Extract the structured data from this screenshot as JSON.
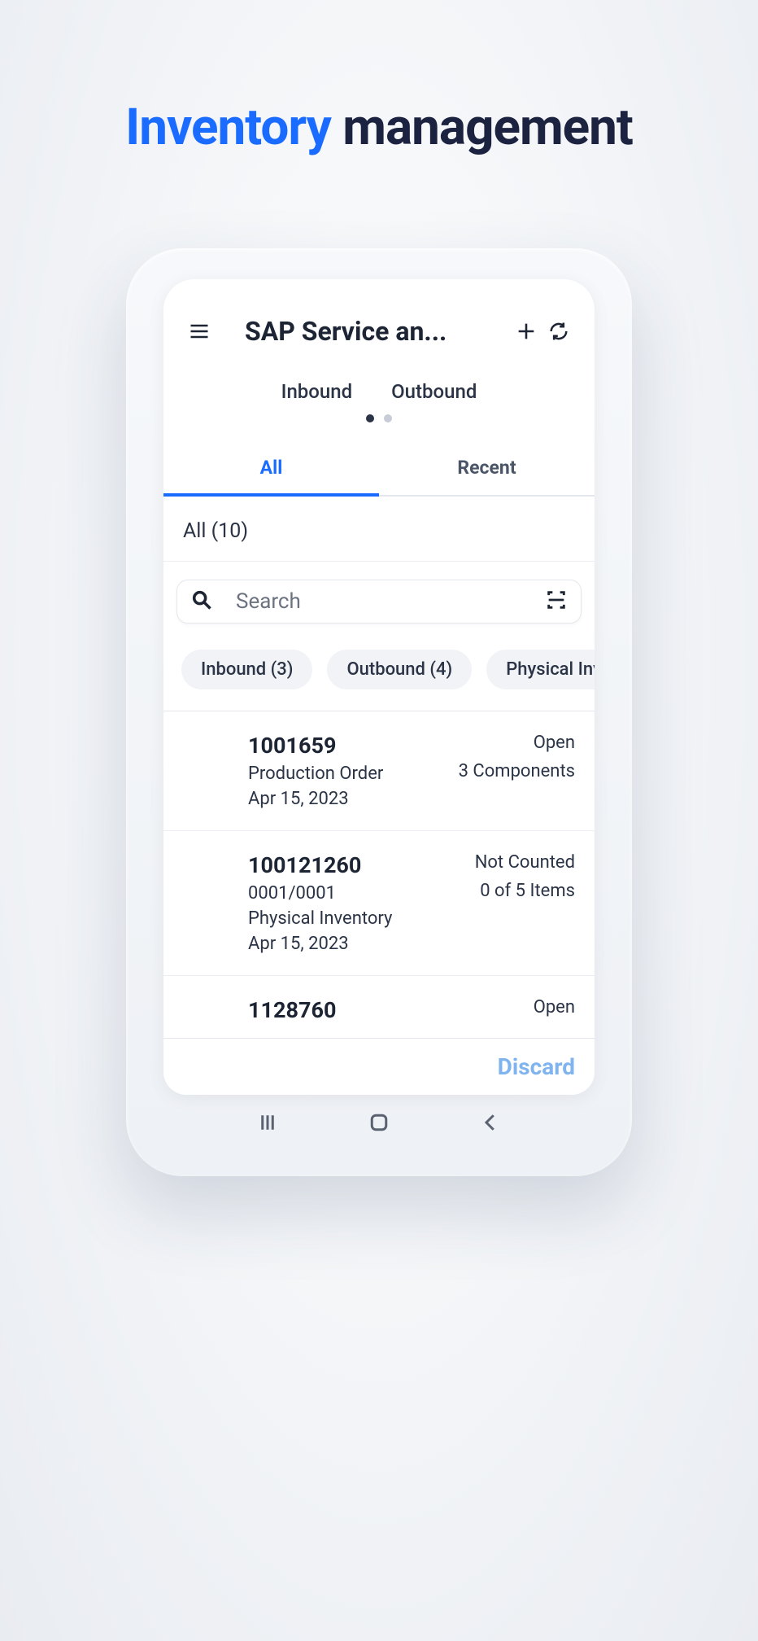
{
  "hero": {
    "accent": "Inventory",
    "rest": " management"
  },
  "appbar": {
    "title": "SAP Service an..."
  },
  "subTabs": [
    "Inbound",
    "Outbound"
  ],
  "mainTabs": {
    "all": "All",
    "recent": "Recent"
  },
  "sectionTitle": "All (10)",
  "search": {
    "placeholder": "Search"
  },
  "chips": [
    "Inbound (3)",
    "Outbound (4)",
    "Physical Inver"
  ],
  "rows": [
    {
      "id": "1001659",
      "type": "Production Order",
      "date": "Apr 15, 2023",
      "status": "Open",
      "meta": "3 Components"
    },
    {
      "id": "100121260",
      "sub": "0001/0001",
      "type": "Physical Inventory",
      "date": "Apr 15, 2023",
      "status": "Not Counted",
      "meta": "0 of 5 Items"
    },
    {
      "id": "1128760",
      "status": "Open"
    }
  ],
  "footer": {
    "discard": "Discard"
  }
}
